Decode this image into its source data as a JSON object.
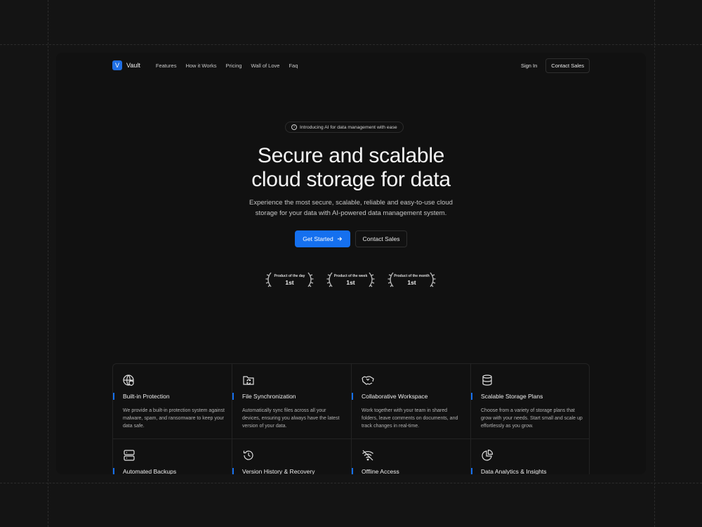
{
  "nav": {
    "brand_letter": "V",
    "brand_name": "Vault",
    "links": [
      "Features",
      "How it Works",
      "Pricing",
      "Wall of Love",
      "Faq"
    ],
    "sign_in": "Sign In",
    "contact_sales": "Contact Sales"
  },
  "hero": {
    "badge": "Introducing AI for data management with ease",
    "title_line1": "Secure and scalable",
    "title_line2": "cloud storage for data",
    "subtitle_line1": "Experience the most secure, scalable, reliable and easy-to-use cloud",
    "subtitle_line2": "storage for your data with AI-powered data management system.",
    "cta_primary": "Get Started",
    "cta_secondary": "Contact Sales"
  },
  "awards": [
    {
      "label": "Product of the day",
      "rank": "1st"
    },
    {
      "label": "Product of the week",
      "rank": "1st"
    },
    {
      "label": "Product of the month",
      "rank": "1st"
    }
  ],
  "features": [
    {
      "icon": "globe-shield-icon",
      "title": "Built-in Protection",
      "desc": "We provide a built-in protection system against malware, spam, and ransomware to keep your data safe."
    },
    {
      "icon": "folder-sync-icon",
      "title": "File Synchronization",
      "desc": "Automatically sync files across all your devices, ensuring you always have the latest version of your data."
    },
    {
      "icon": "handshake-icon",
      "title": "Collaborative Workspace",
      "desc": "Work together with your team in shared folders, leave comments on documents, and track changes in real-time."
    },
    {
      "icon": "database-icon",
      "title": "Scalable Storage Plans",
      "desc": "Choose from a variety of storage plans that grow with your needs. Start small and scale up effortlessly as you grow."
    },
    {
      "icon": "server-icon",
      "title": "Automated Backups",
      "desc": ""
    },
    {
      "icon": "history-icon",
      "title": "Version History & Recovery",
      "desc": ""
    },
    {
      "icon": "wifi-off-icon",
      "title": "Offline Access",
      "desc": ""
    },
    {
      "icon": "pie-chart-icon",
      "title": "Data Analytics & Insights",
      "desc": ""
    }
  ],
  "colors": {
    "accent": "#1570ef",
    "background": "#111111",
    "page": "#141414"
  }
}
